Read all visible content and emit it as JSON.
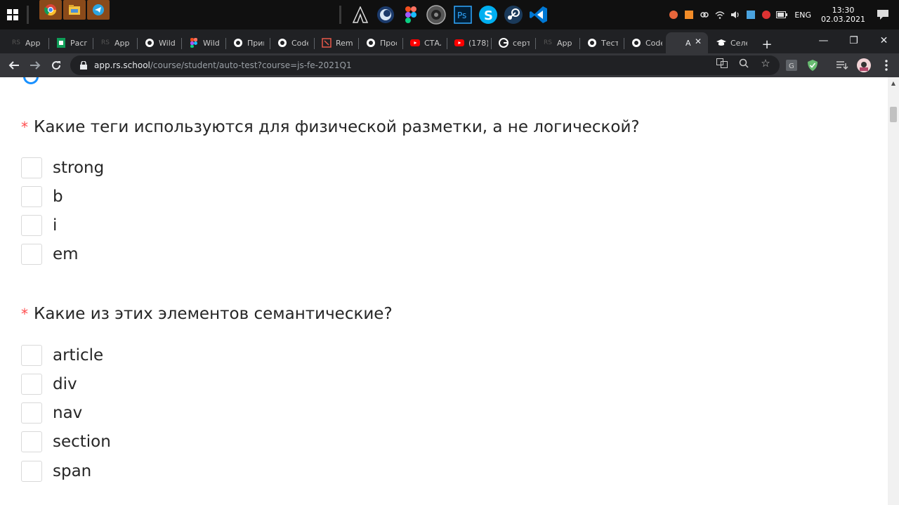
{
  "taskbar": {
    "apps": [
      {
        "icon": "chrome-icon"
      },
      {
        "icon": "file-explorer-icon"
      },
      {
        "icon": "telegram-icon"
      },
      {
        "icon": "assassins-creed-icon"
      },
      {
        "icon": "cinema4d-icon"
      },
      {
        "icon": "figma-icon"
      },
      {
        "icon": "audio-app-icon"
      },
      {
        "icon": "photoshop-icon"
      },
      {
        "icon": "skype-icon"
      },
      {
        "icon": "steam-icon"
      },
      {
        "icon": "vscode-icon"
      }
    ],
    "language": "ENG",
    "time": "13:30",
    "date": "02.03.2021"
  },
  "tabs": [
    {
      "label": "App",
      "icon": "rs-icon"
    },
    {
      "label": "Расп",
      "icon": "sheets-icon"
    },
    {
      "label": "App",
      "icon": "rs-icon"
    },
    {
      "label": "Wildl",
      "icon": "globe-icon"
    },
    {
      "label": "Wildl",
      "icon": "figma-icon"
    },
    {
      "label": "Прив",
      "icon": "globe-icon"
    },
    {
      "label": "Code",
      "icon": "globe-icon"
    },
    {
      "label": "Rem",
      "icon": "remnote-icon"
    },
    {
      "label": "Прос",
      "icon": "globe-icon"
    },
    {
      "label": "СТАЛ",
      "icon": "youtube-icon"
    },
    {
      "label": "(178)",
      "icon": "youtube-icon"
    },
    {
      "label": "серт",
      "icon": "google-icon"
    },
    {
      "label": "App",
      "icon": "rs-icon"
    },
    {
      "label": "Тест",
      "icon": "globe-icon"
    },
    {
      "label": "Code",
      "icon": "globe-icon"
    },
    {
      "label": "A",
      "icon": "",
      "active": true
    },
    {
      "label": "Селе",
      "icon": "graduation-icon"
    }
  ],
  "toolbar": {
    "url_host": "app.rs.school",
    "url_path": "/course/student/auto-test?course=js-fe-2021Q1"
  },
  "questions": [
    {
      "required_mark": "*",
      "text": "Какие теги используются для физической разметки, а не логической?",
      "options": [
        "strong",
        "b",
        "i",
        "em"
      ]
    },
    {
      "required_mark": "*",
      "text": "Какие из этих элементов семантические?",
      "options": [
        "article",
        "div",
        "nav",
        "section",
        "span"
      ]
    }
  ],
  "colors": {
    "accent": "#1890ff",
    "required": "#ff4d4f",
    "text": "#262626",
    "checkbox_border": "#d9d9d9"
  }
}
